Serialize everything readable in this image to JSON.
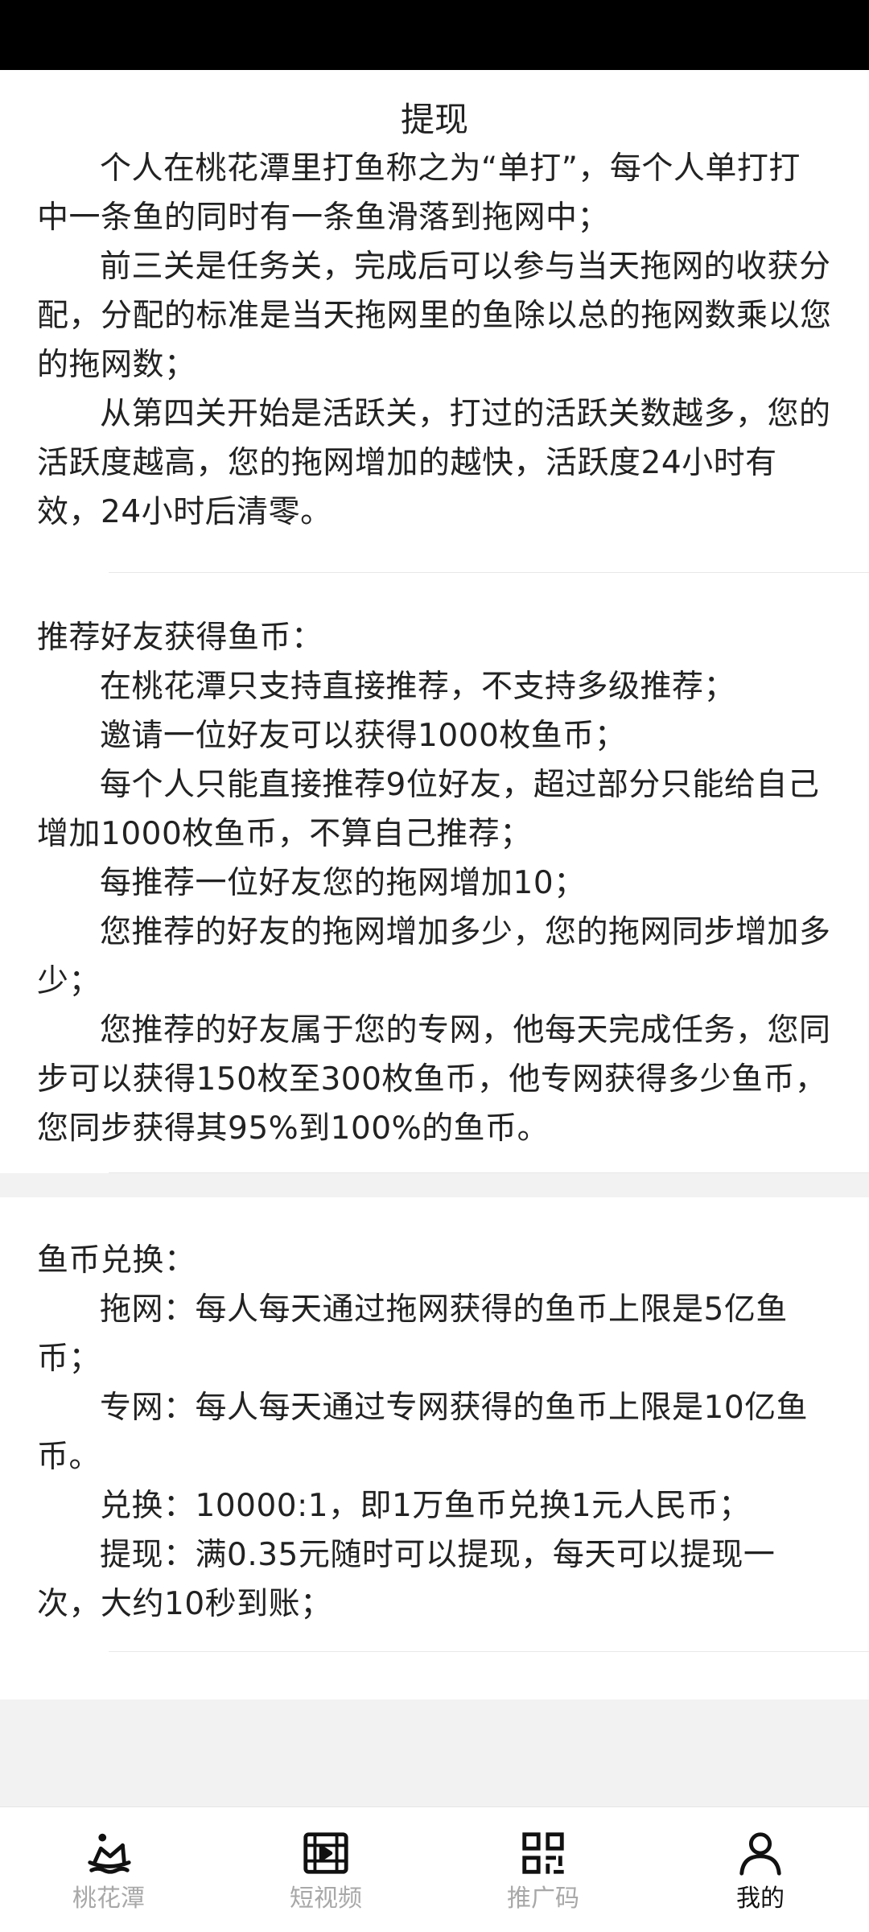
{
  "page": {
    "title": "提现"
  },
  "section1": {
    "paragraphs": [
      "个人在桃花潭里打鱼称之为“单打”，每个人单打打中一条鱼的同时有一条鱼滑落到拖网中；",
      "前三关是任务关，完成后可以参与当天拖网的收获分配，分配的标准是当天拖网里的鱼除以总的拖网数乘以您的拖网数；",
      "从第四关开始是活跃关，打过的活跃关数越多，您的活跃度越高，您的拖网增加的越快，活跃度24小时有效，24小时后清零。"
    ]
  },
  "section2": {
    "heading": "推荐好友获得鱼币：",
    "paragraphs": [
      "在桃花潭只支持直接推荐，不支持多级推荐；",
      "邀请一位好友可以获得1000枚鱼币；",
      "每个人只能直接推荐9位好友，超过部分只能给自己增加1000枚鱼币，不算自己推荐；",
      "每推荐一位好友您的拖网增加10；",
      "您推荐的好友的拖网增加多少，您的拖网同步增加多少；",
      "您推荐的好友属于您的专网，他每天完成任务，您同步可以获得150枚至300枚鱼币，他专网获得多少鱼币，您同步获得其95%到100%的鱼币。"
    ]
  },
  "section3": {
    "heading": "鱼币兑换：",
    "paragraphs": [
      "拖网：每人每天通过拖网获得的鱼币上限是5亿鱼币；",
      "专网：每人每天通过专网获得的鱼币上限是10亿鱼币。",
      "兑换：10000:1，即1万鱼币兑换1元人民币；",
      "提现：满0.35元随时可以提现，每天可以提现一次，大约10秒到账；"
    ]
  },
  "tabbar": {
    "tabs": [
      {
        "label": "桃花潭",
        "icon": "fishing-icon",
        "active": false
      },
      {
        "label": "短视频",
        "icon": "film-icon",
        "active": false
      },
      {
        "label": "推广码",
        "icon": "qrcode-icon",
        "active": false
      },
      {
        "label": "我的",
        "icon": "user-icon",
        "active": true
      }
    ],
    "active_color": "#111111",
    "inactive_color": "#a8a8a8"
  }
}
